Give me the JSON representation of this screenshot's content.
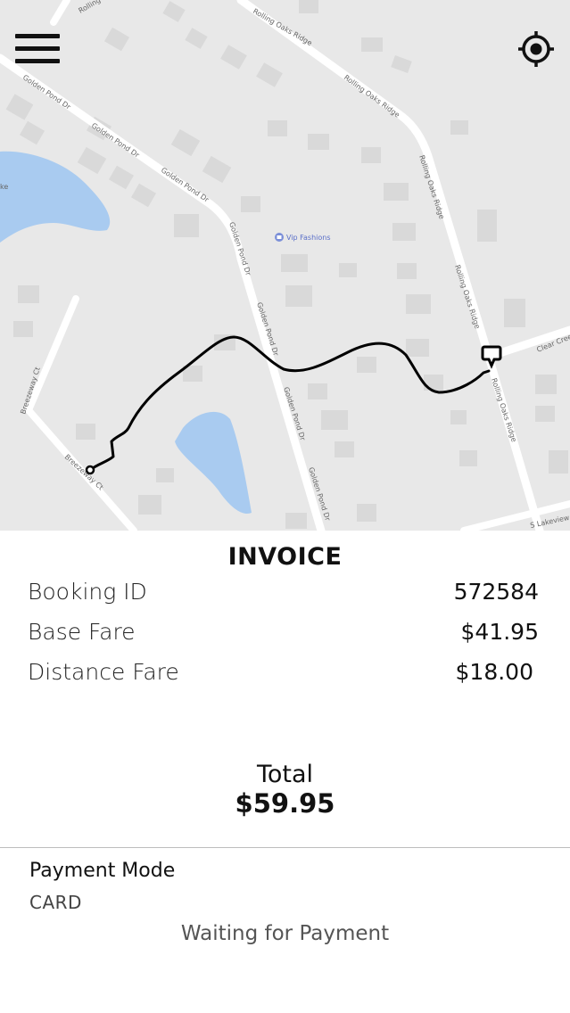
{
  "map": {
    "poi_label": "Vip Fashions",
    "streets": [
      "Rolling",
      "Rolling Oaks Ridge",
      "Rolling Oaks Ridge",
      "Rolling Oaks Ridge",
      "Rolling Oaks Ridge",
      "Golden Pond Dr",
      "Golden Pond Dr",
      "Golden Pond Dr",
      "Golden Pond Dr",
      "Golden Pond Dr",
      "Golden Pond Dr",
      "Golden Pond Dr",
      "Breezeway Ct",
      "Breezeway Ct",
      "Clear Creek",
      "S Lakeview",
      "ke"
    ]
  },
  "invoice": {
    "title": "INVOICE",
    "rows": [
      {
        "label": "Booking ID",
        "value": "572584"
      },
      {
        "label": "Base Fare",
        "value": "$41.95"
      },
      {
        "label": "Distance Fare",
        "value": "$18.00"
      }
    ],
    "total_label": "Total",
    "total_value": "$59.95"
  },
  "payment": {
    "mode_label": "Payment Mode",
    "mode_value": "CARD",
    "status": "Waiting for Payment"
  },
  "colors": {
    "map_bg": "#e8e8e8",
    "road": "#ffffff",
    "water": "#a9cbf0",
    "building": "#d9d9d9",
    "route": "#000000"
  },
  "icons": {
    "menu": "hamburger-menu-icon",
    "locate": "crosshair-location-icon",
    "pickup": "pickup-marker-icon",
    "dropoff": "dropoff-marker-icon",
    "poi": "shopping-bag-icon"
  }
}
